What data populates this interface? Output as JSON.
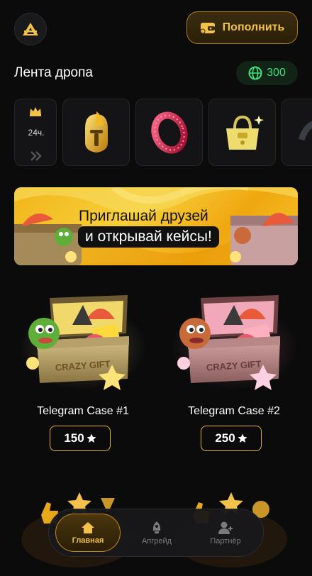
{
  "header": {
    "logo_icon": "triangle-logo-icon",
    "topup_label": "Пополнить",
    "topup_icon": "wallet-icon"
  },
  "drop_feed": {
    "title": "Лента дропа",
    "balance_icon": "globe-icon",
    "balance_value": "300",
    "timer_label": "24ч.",
    "items": [
      {
        "name": "golden-helmet"
      },
      {
        "name": "red-ring"
      },
      {
        "name": "yellow-bag"
      },
      {
        "name": "dark-item"
      }
    ]
  },
  "banner": {
    "line1": "Приглашай друзей",
    "line2": "и открывай кейсы!"
  },
  "cases": [
    {
      "name": "Telegram Case #1",
      "price": "150",
      "theme": "gold"
    },
    {
      "name": "Telegram Case #2",
      "price": "250",
      "theme": "pink"
    }
  ],
  "nav": {
    "items": [
      {
        "label": "Главная",
        "icon": "home-icon",
        "active": true
      },
      {
        "label": "Апгрейд",
        "icon": "rocket-icon",
        "active": false
      },
      {
        "label": "Партнёр",
        "icon": "user-plus-icon",
        "active": false
      }
    ]
  },
  "colors": {
    "accent": "#f3c24a",
    "balance": "#3ee07d",
    "background": "#0b0b0c"
  }
}
